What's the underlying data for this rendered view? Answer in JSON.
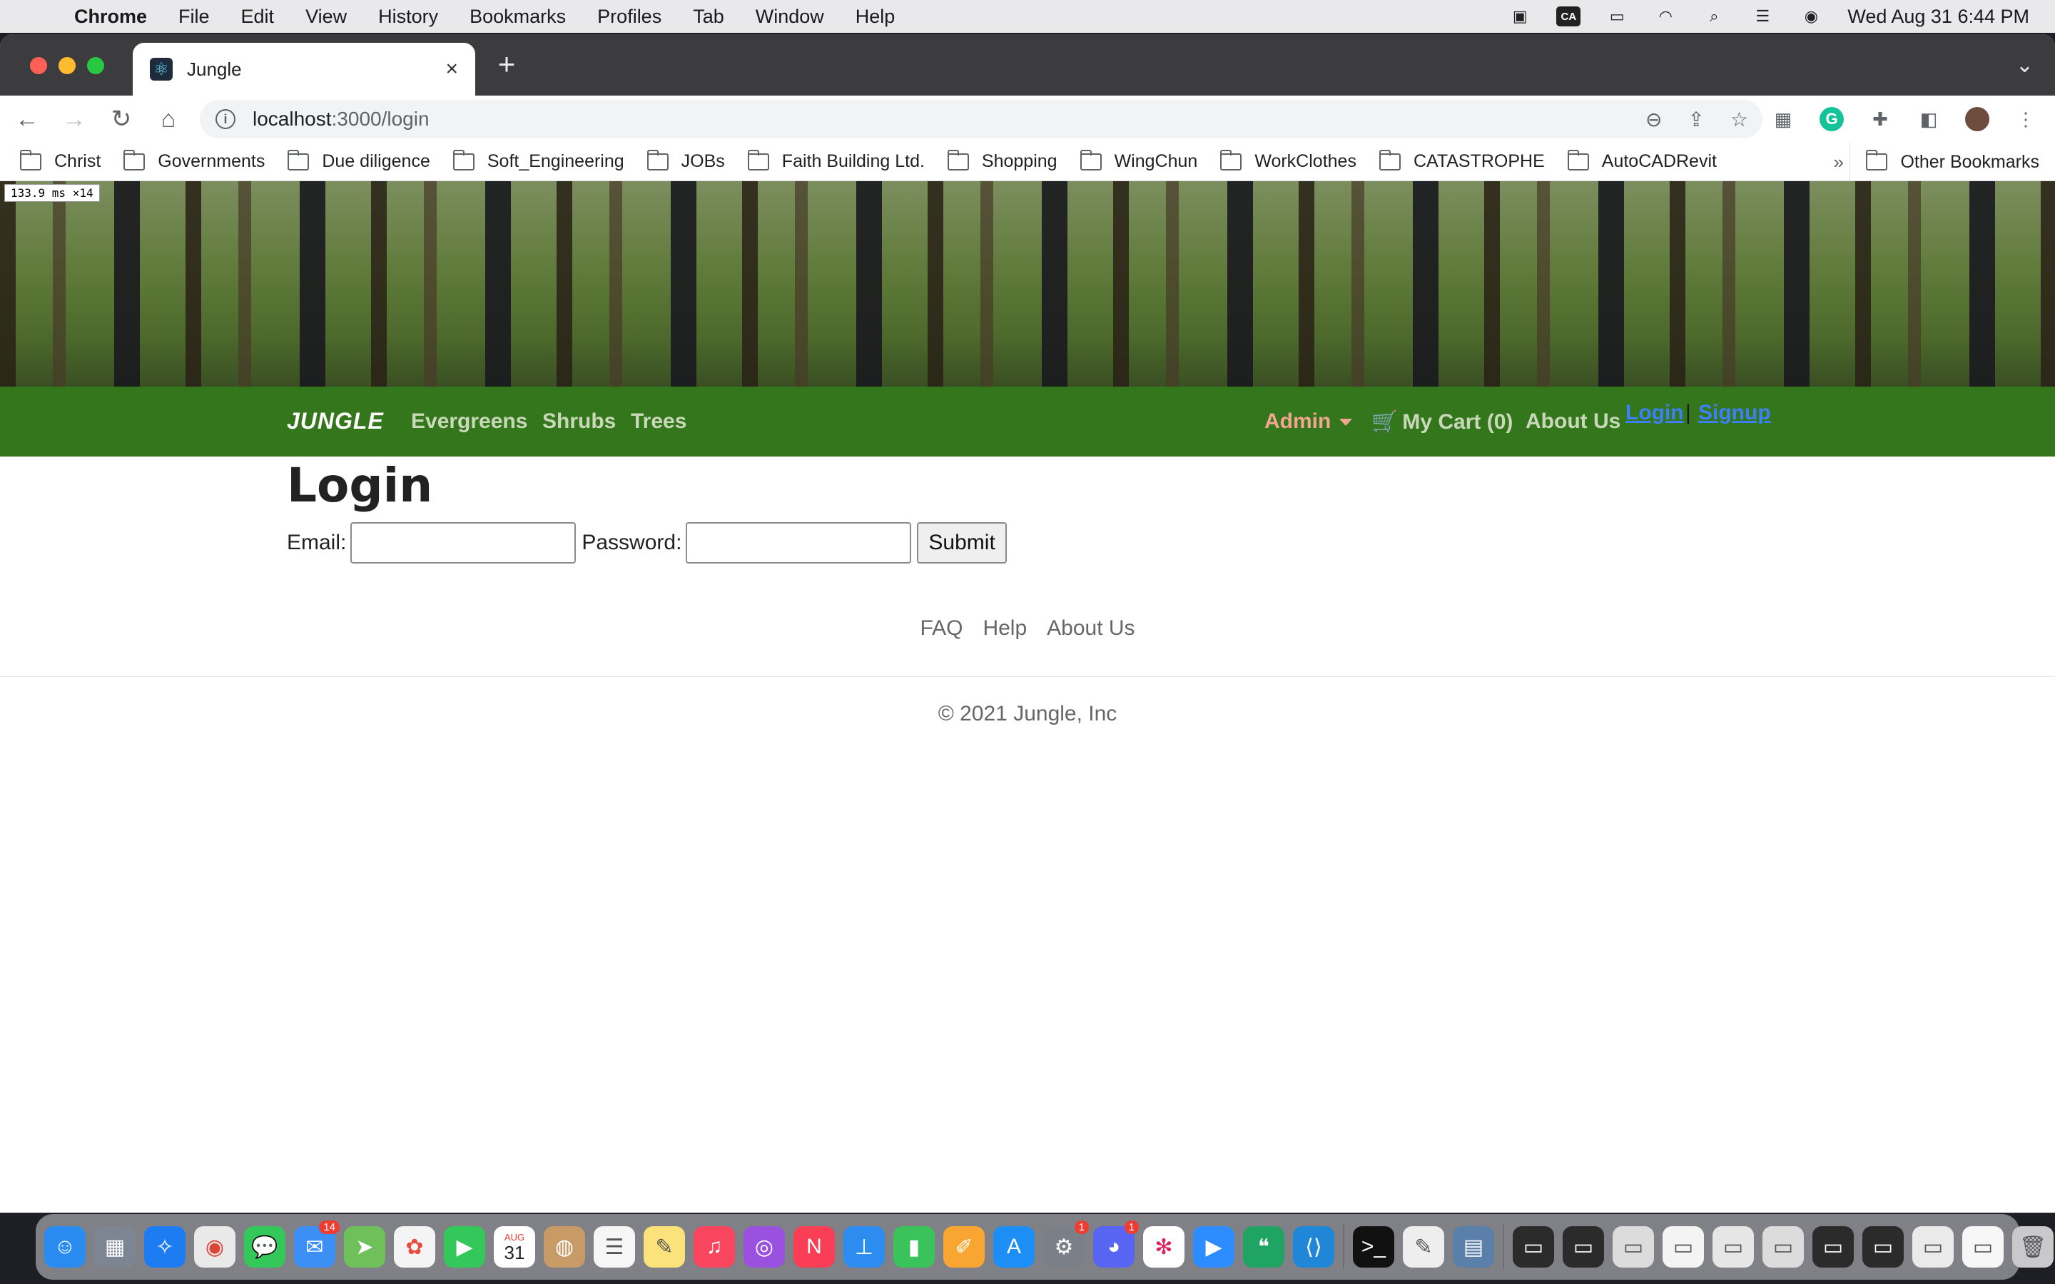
{
  "menubar": {
    "apple_icon": "apple-icon",
    "app_name": "Chrome",
    "items": [
      "File",
      "Edit",
      "View",
      "History",
      "Bookmarks",
      "Profiles",
      "Tab",
      "Window",
      "Help"
    ],
    "status_icons": [
      "monitor-icon",
      "ca-icon",
      "battery-icon",
      "wifi-icon",
      "search-icon",
      "control-center-icon",
      "siri-icon"
    ],
    "ca_label": "CA",
    "clock": "Wed Aug 31  6:44 PM"
  },
  "browser": {
    "tab_title": "Jungle",
    "tab_close": "×",
    "new_tab": "+",
    "url_host": "localhost",
    "url_rest": ":3000/login",
    "bookmarks": [
      "Christ",
      "Governments",
      "Due diligence",
      "Soft_Engineering",
      "JOBs",
      "Faith Building Ltd.",
      "Shopping",
      "WingChun",
      "WorkClothes",
      "CATASTROPHE",
      "AutoCADRevit"
    ],
    "bookmarks_more": "»",
    "other_bookmarks": "Other Bookmarks"
  },
  "page": {
    "perf_badge": "133.9 ms ×14",
    "nav": {
      "brand": "JUNGLE",
      "links": [
        "Evergreens",
        "Shrubs",
        "Trees"
      ],
      "admin": "Admin",
      "cart": "My Cart (0)",
      "about": "About Us",
      "login": "Login",
      "separator": "|",
      "signup": "Signup"
    },
    "title": "Login",
    "form": {
      "email_label": "Email:",
      "email_value": "",
      "password_label": "Password:",
      "password_value": "",
      "submit": "Submit"
    },
    "footer": {
      "links": [
        "FAQ",
        "Help",
        "About Us"
      ],
      "copyright": "© 2021 Jungle, Inc"
    }
  },
  "dock": {
    "calendar_month": "AUG",
    "calendar_day": "31",
    "mail_badge": "14",
    "settings_badge": "1",
    "discord_badge": "1"
  },
  "colors": {
    "navbar": "#34761c",
    "admin": "#f2a58f",
    "auth_link": "#3d80f5"
  }
}
